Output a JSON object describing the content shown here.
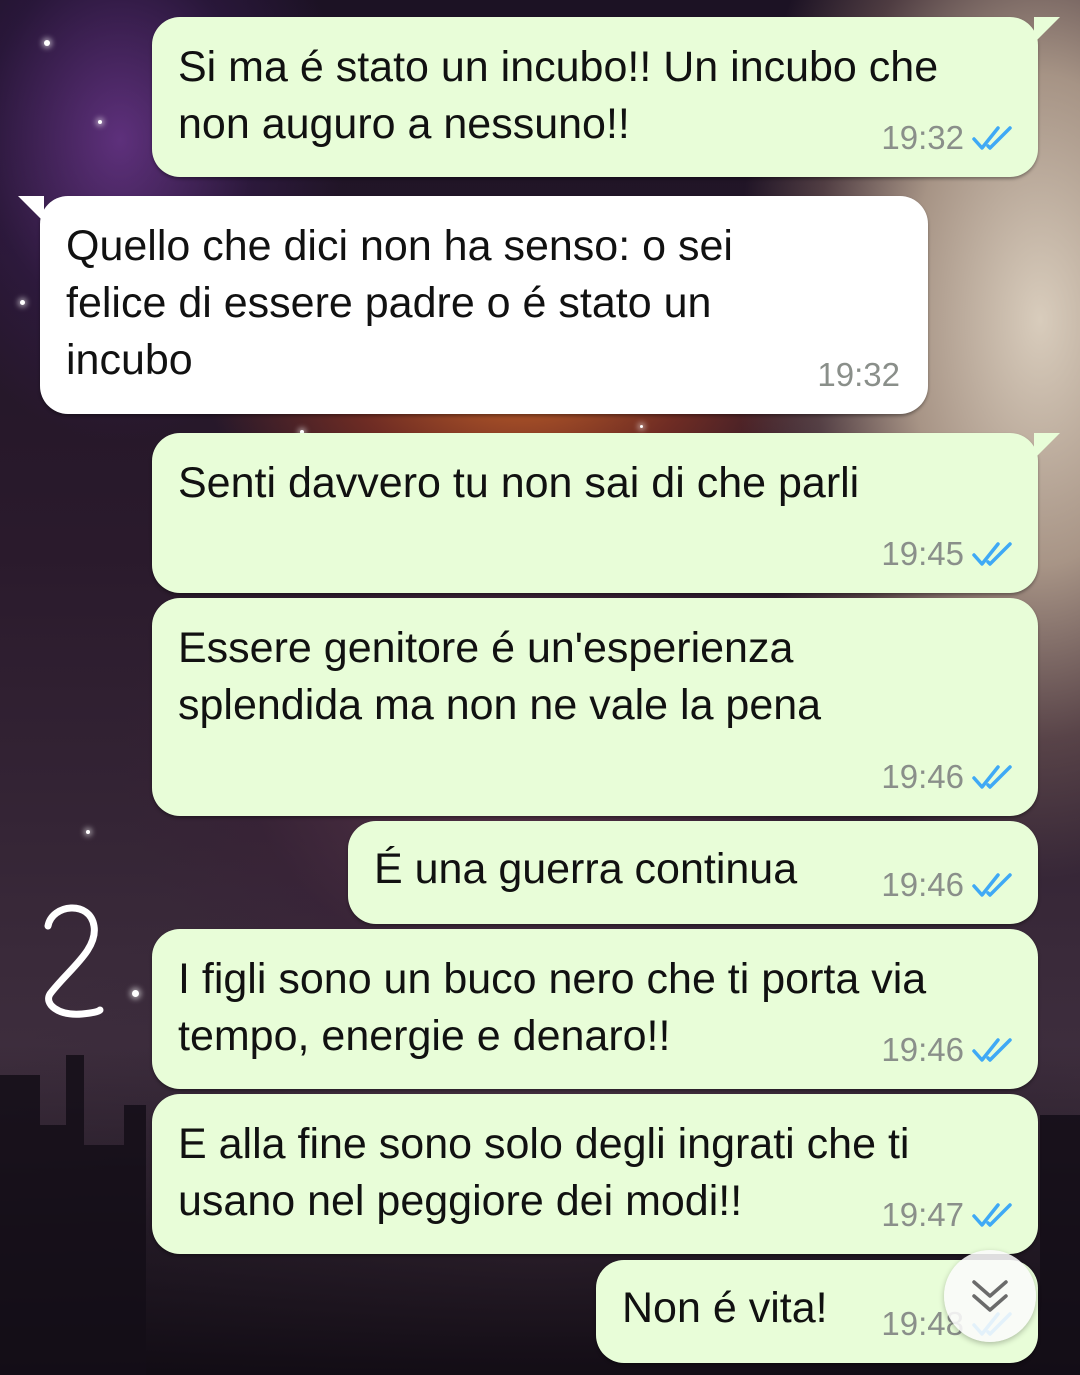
{
  "colors": {
    "outgoing_bubble": "#e8fdd8",
    "incoming_bubble": "#ffffff",
    "read_ticks": "#3fa9f5",
    "timestamp": "#8a8f8a"
  },
  "messages": [
    {
      "direction": "outgoing",
      "text": "Si ma é stato un incubo!! Un incubo che\nnon auguro a nessuno!!",
      "time": "19:32",
      "status_icon": "double-check-read-icon"
    },
    {
      "direction": "incoming",
      "text": "Quello che dici non ha senso: o sei\nfelice di essere padre o é stato un\nincubo",
      "time": "19:32"
    },
    {
      "direction": "outgoing",
      "text": "Senti davvero tu non sai di che parli",
      "time": "19:45",
      "status_icon": "double-check-read-icon"
    },
    {
      "direction": "outgoing",
      "text": "Essere genitore é un'esperienza\nsplendida ma non ne vale la pena",
      "time": "19:46",
      "status_icon": "double-check-read-icon"
    },
    {
      "direction": "outgoing",
      "text": "É una guerra continua",
      "time": "19:46",
      "status_icon": "double-check-read-icon"
    },
    {
      "direction": "outgoing",
      "text": "I figli sono un buco nero che ti porta via\ntempo, energie e denaro!!",
      "time": "19:46",
      "status_icon": "double-check-read-icon"
    },
    {
      "direction": "outgoing",
      "text": "E alla fine sono solo degli ingrati che ti\nusano nel peggiore dei modi!!",
      "time": "19:47",
      "status_icon": "double-check-read-icon"
    },
    {
      "direction": "outgoing",
      "text": "Non é vita!",
      "time": "19:48",
      "status_icon": "double-check-read-icon"
    }
  ],
  "annotation": {
    "text": "2"
  },
  "scroll_button": {
    "icon": "double-chevron-down-icon"
  }
}
